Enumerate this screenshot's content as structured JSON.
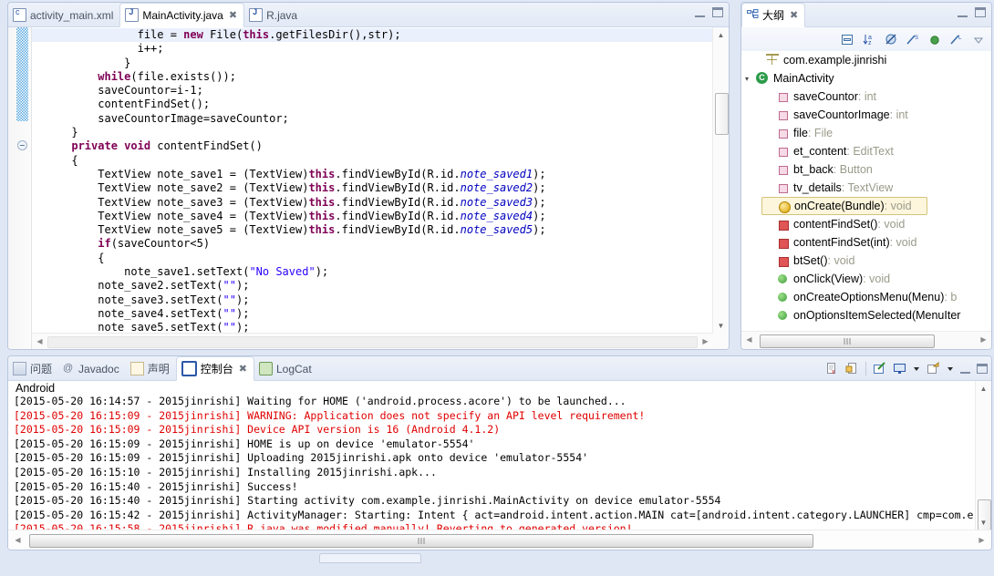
{
  "editor": {
    "tabs": [
      {
        "label": "activity_main.xml",
        "icon": "xml-file-icon",
        "active": false,
        "closable": false
      },
      {
        "label": "MainActivity.java",
        "icon": "java-file-icon",
        "active": true,
        "closable": true
      },
      {
        "label": "R.java",
        "icon": "java-file-icon",
        "active": false,
        "closable": false
      }
    ],
    "close_glyph": "✖",
    "minimize_label": "Minimize",
    "maximize_label": "Maximize",
    "code_lines": [
      {
        "indent": 8,
        "highlight": true,
        "tokens": [
          {
            "t": "file = ",
            "c": "cls"
          },
          {
            "t": "new ",
            "c": "kw"
          },
          {
            "t": "File(",
            "c": "cls"
          },
          {
            "t": "this",
            "c": "kw"
          },
          {
            "t": ".getFilesDir(),str);",
            "c": "cls"
          }
        ]
      },
      {
        "indent": 8,
        "highlight": false,
        "tokens": [
          {
            "t": "i++;",
            "c": "cls"
          }
        ]
      },
      {
        "indent": 7,
        "highlight": false,
        "tokens": [
          {
            "t": "}",
            "c": "cls"
          }
        ]
      },
      {
        "indent": 5,
        "highlight": false,
        "tokens": [
          {
            "t": "while",
            "c": "kw"
          },
          {
            "t": "(file.exists());",
            "c": "cls"
          }
        ]
      },
      {
        "indent": 5,
        "highlight": false,
        "tokens": [
          {
            "t": "saveCountor=i-1;",
            "c": "cls"
          }
        ]
      },
      {
        "indent": 5,
        "highlight": false,
        "tokens": [
          {
            "t": "contentFindSet();",
            "c": "cls"
          }
        ]
      },
      {
        "indent": 5,
        "highlight": false,
        "tokens": [
          {
            "t": "saveCountorImage=saveCountor;",
            "c": "cls"
          }
        ]
      },
      {
        "indent": 3,
        "highlight": false,
        "tokens": [
          {
            "t": "}",
            "c": "cls"
          }
        ]
      },
      {
        "indent": 3,
        "highlight": false,
        "tokens": [
          {
            "t": "private void ",
            "c": "kw"
          },
          {
            "t": "contentFindSet()",
            "c": "cls"
          }
        ]
      },
      {
        "indent": 3,
        "highlight": false,
        "tokens": [
          {
            "t": "{",
            "c": "cls"
          }
        ]
      },
      {
        "indent": 5,
        "highlight": false,
        "tokens": [
          {
            "t": "TextView note_save1 = (TextView)",
            "c": "cls"
          },
          {
            "t": "this",
            "c": "kw"
          },
          {
            "t": ".findViewById(R.id.",
            "c": "cls"
          },
          {
            "t": "note_saved1",
            "c": "fld"
          },
          {
            "t": ");",
            "c": "cls"
          }
        ]
      },
      {
        "indent": 5,
        "highlight": false,
        "tokens": [
          {
            "t": "TextView note_save2 = (TextView)",
            "c": "cls"
          },
          {
            "t": "this",
            "c": "kw"
          },
          {
            "t": ".findViewById(R.id.",
            "c": "cls"
          },
          {
            "t": "note_saved2",
            "c": "fld"
          },
          {
            "t": ");",
            "c": "cls"
          }
        ]
      },
      {
        "indent": 5,
        "highlight": false,
        "tokens": [
          {
            "t": "TextView note_save3 = (TextView)",
            "c": "cls"
          },
          {
            "t": "this",
            "c": "kw"
          },
          {
            "t": ".findViewById(R.id.",
            "c": "cls"
          },
          {
            "t": "note_saved3",
            "c": "fld"
          },
          {
            "t": ");",
            "c": "cls"
          }
        ]
      },
      {
        "indent": 5,
        "highlight": false,
        "tokens": [
          {
            "t": "TextView note_save4 = (TextView)",
            "c": "cls"
          },
          {
            "t": "this",
            "c": "kw"
          },
          {
            "t": ".findViewById(R.id.",
            "c": "cls"
          },
          {
            "t": "note_saved4",
            "c": "fld"
          },
          {
            "t": ");",
            "c": "cls"
          }
        ]
      },
      {
        "indent": 5,
        "highlight": false,
        "tokens": [
          {
            "t": "TextView note_save5 = (TextView)",
            "c": "cls"
          },
          {
            "t": "this",
            "c": "kw"
          },
          {
            "t": ".findViewById(R.id.",
            "c": "cls"
          },
          {
            "t": "note_saved5",
            "c": "fld"
          },
          {
            "t": ");",
            "c": "cls"
          }
        ]
      },
      {
        "indent": 5,
        "highlight": false,
        "tokens": [
          {
            "t": "if",
            "c": "kw"
          },
          {
            "t": "(saveCountor<5)",
            "c": "cls"
          }
        ]
      },
      {
        "indent": 5,
        "highlight": false,
        "tokens": [
          {
            "t": "{",
            "c": "cls"
          }
        ]
      },
      {
        "indent": 7,
        "highlight": false,
        "tokens": [
          {
            "t": "note_save1.setText(",
            "c": "cls"
          },
          {
            "t": "\"No Saved\"",
            "c": "str"
          },
          {
            "t": ");",
            "c": "cls"
          }
        ]
      },
      {
        "indent": 5,
        "highlight": false,
        "tokens": [
          {
            "t": "note_save2.setText(",
            "c": "cls"
          },
          {
            "t": "\"\"",
            "c": "str"
          },
          {
            "t": ");",
            "c": "cls"
          }
        ]
      },
      {
        "indent": 5,
        "highlight": false,
        "tokens": [
          {
            "t": "note_save3.setText(",
            "c": "cls"
          },
          {
            "t": "\"\"",
            "c": "str"
          },
          {
            "t": ");",
            "c": "cls"
          }
        ]
      },
      {
        "indent": 5,
        "highlight": false,
        "tokens": [
          {
            "t": "note_save4.setText(",
            "c": "cls"
          },
          {
            "t": "\"\"",
            "c": "str"
          },
          {
            "t": ");",
            "c": "cls"
          }
        ]
      },
      {
        "indent": 5,
        "highlight": false,
        "tokens": [
          {
            "t": "note_save5.setText(",
            "c": "cls"
          },
          {
            "t": "\"\"",
            "c": "str"
          },
          {
            "t": ");",
            "c": "cls"
          }
        ]
      }
    ]
  },
  "outline": {
    "title": "大纲",
    "close_glyph": "✖",
    "toolbar_icons": [
      "collapse-all-icon",
      "sort-alphabetically-icon",
      "hide-fields-icon",
      "hide-static-icon",
      "hide-non-public-icon",
      "hide-local-types-icon",
      "view-menu-icon"
    ],
    "items": [
      {
        "label": "com.example.jinrishi",
        "type": "",
        "icon": "package-icon",
        "depth": 1,
        "expander": "",
        "selected": false
      },
      {
        "label": "MainActivity",
        "type": "",
        "icon": "class-icon",
        "depth": 0,
        "expander": "down",
        "selected": false
      },
      {
        "label": "saveCountor",
        "type": " : int",
        "icon": "field-icon",
        "depth": 2,
        "expander": "",
        "selected": false
      },
      {
        "label": "saveCountorImage",
        "type": " : int",
        "icon": "field-icon",
        "depth": 2,
        "expander": "",
        "selected": false
      },
      {
        "label": "file",
        "type": " : File",
        "icon": "field-icon",
        "depth": 2,
        "expander": "",
        "selected": false
      },
      {
        "label": "et_content",
        "type": " : EditText",
        "icon": "field-icon",
        "depth": 2,
        "expander": "",
        "selected": false
      },
      {
        "label": "bt_back",
        "type": " : Button",
        "icon": "field-icon",
        "depth": 2,
        "expander": "",
        "selected": false
      },
      {
        "label": "tv_details",
        "type": " : TextView",
        "icon": "field-icon",
        "depth": 2,
        "expander": "",
        "selected": false
      },
      {
        "label": "onCreate(Bundle)",
        "type": " : void",
        "icon": "method-override-icon",
        "depth": 2,
        "expander": "",
        "selected": true
      },
      {
        "label": "contentFindSet()",
        "type": " : void",
        "icon": "method-private-icon",
        "depth": 2,
        "expander": "",
        "selected": false
      },
      {
        "label": "contentFindSet(int)",
        "type": " : void",
        "icon": "method-private-icon",
        "depth": 2,
        "expander": "",
        "selected": false
      },
      {
        "label": "btSet()",
        "type": " : void",
        "icon": "method-private-icon",
        "depth": 2,
        "expander": "",
        "selected": false
      },
      {
        "label": "onClick(View)",
        "type": " : void",
        "icon": "method-public-icon",
        "depth": 2,
        "expander": "",
        "selected": false
      },
      {
        "label": "onCreateOptionsMenu(Menu)",
        "type": " : b",
        "icon": "method-public-icon",
        "depth": 2,
        "expander": "",
        "selected": false
      },
      {
        "label": "onOptionsItemSelected(MenuIter",
        "type": "",
        "icon": "method-public-icon",
        "depth": 2,
        "expander": "",
        "selected": false
      }
    ]
  },
  "console": {
    "tabs": [
      {
        "label": "问题",
        "icon": "problems-icon",
        "active": false,
        "closable": false
      },
      {
        "label": "Javadoc",
        "icon": "javadoc-icon",
        "active": false,
        "closable": false
      },
      {
        "label": "声明",
        "icon": "declaration-icon",
        "active": false,
        "closable": false
      },
      {
        "label": "控制台",
        "icon": "console-icon",
        "active": true,
        "closable": true
      },
      {
        "label": "LogCat",
        "icon": "logcat-icon",
        "active": false,
        "closable": false
      }
    ],
    "close_glyph": "✖",
    "stream_title": "Android",
    "toolbar_icons": [
      "remove-launch-icon",
      "remove-all-terminated-icon",
      "separator",
      "open-console-icon",
      "display-selected-console-icon",
      "display-console-dropdown-icon",
      "new-console-view-icon",
      "new-console-dropdown-icon",
      "minimize-icon",
      "maximize-icon"
    ],
    "log_lines": [
      {
        "error": false,
        "text": "[2015-05-20 16:14:57 - 2015jinrishi] Waiting for HOME ('android.process.acore') to be launched..."
      },
      {
        "error": true,
        "text": "[2015-05-20 16:15:09 - 2015jinrishi] WARNING: Application does not specify an API level requirement!"
      },
      {
        "error": true,
        "text": "[2015-05-20 16:15:09 - 2015jinrishi] Device API version is 16 (Android 4.1.2)"
      },
      {
        "error": false,
        "text": "[2015-05-20 16:15:09 - 2015jinrishi] HOME is up on device 'emulator-5554'"
      },
      {
        "error": false,
        "text": "[2015-05-20 16:15:09 - 2015jinrishi] Uploading 2015jinrishi.apk onto device 'emulator-5554'"
      },
      {
        "error": false,
        "text": "[2015-05-20 16:15:10 - 2015jinrishi] Installing 2015jinrishi.apk..."
      },
      {
        "error": false,
        "text": "[2015-05-20 16:15:40 - 2015jinrishi] Success!"
      },
      {
        "error": false,
        "text": "[2015-05-20 16:15:40 - 2015jinrishi] Starting activity com.example.jinrishi.MainActivity on device emulator-5554"
      },
      {
        "error": false,
        "text": "[2015-05-20 16:15:42 - 2015jinrishi] ActivityManager: Starting: Intent { act=android.intent.action.MAIN cat=[android.intent.category.LAUNCHER] cmp=com.e"
      },
      {
        "error": true,
        "text": "[2015-05-20 16:15:58 - 2015jinrishi] R.java was modified manually! Reverting to generated version!"
      }
    ]
  },
  "colors": {
    "accent": "#2b57a8",
    "error_text": "#e00000",
    "keyword": "#7f0055",
    "string": "#2a00ff",
    "field": "#0000c0",
    "selection": "#eaf0fc",
    "outline_selected": "#fdf6dd",
    "window_bg": "#dfe7f5"
  }
}
